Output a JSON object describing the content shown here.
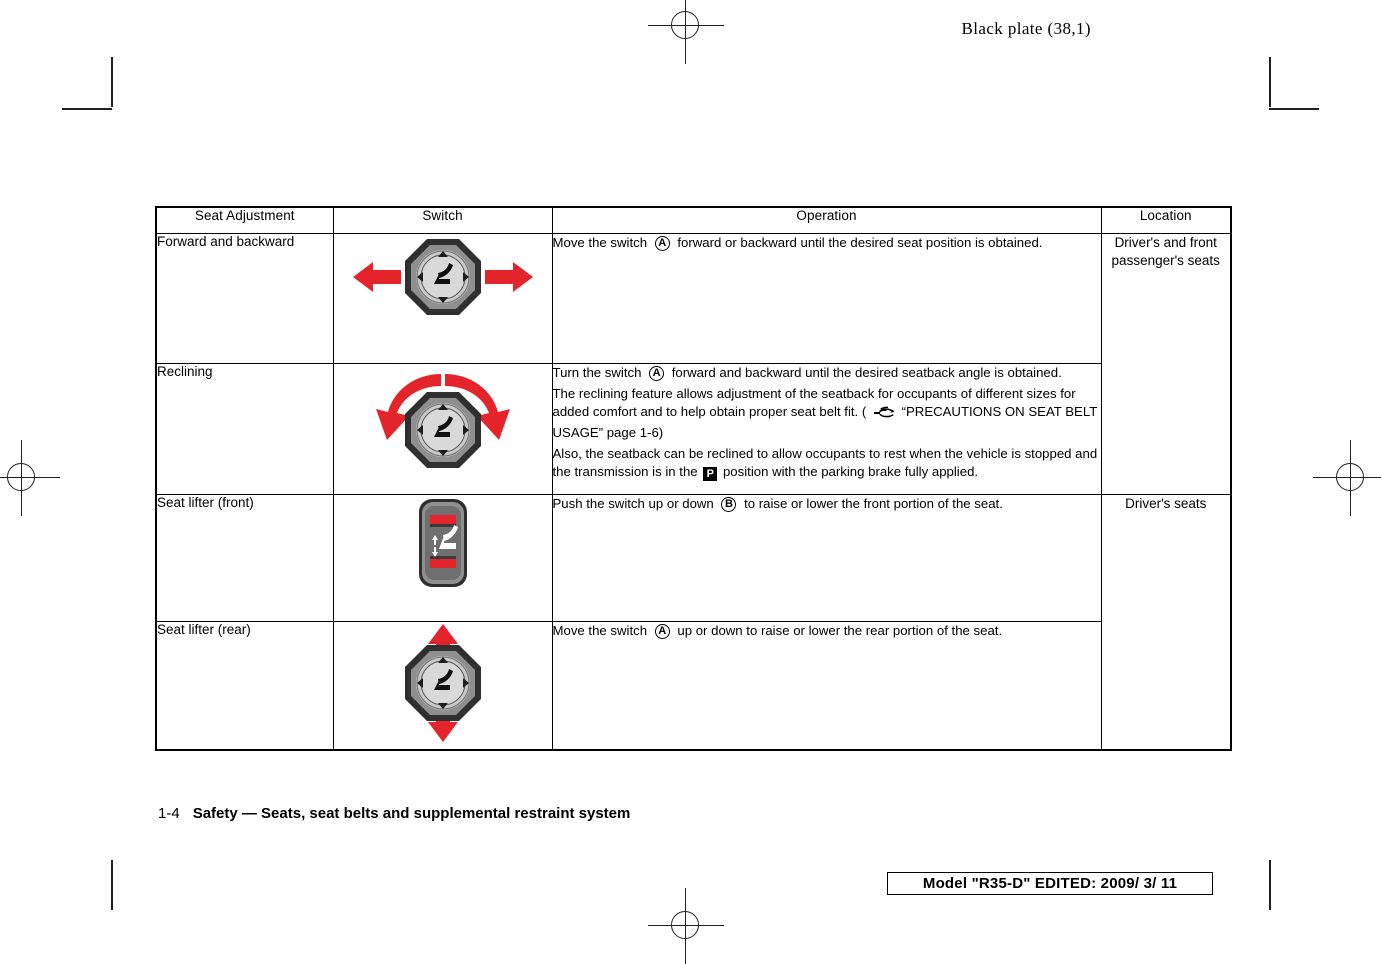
{
  "page": {
    "plate_label": "Black plate (38,1)",
    "footer_page_number": "1-4",
    "footer_title": "Safety — Seats, seat belts and supplemental restraint system",
    "model_stamp": "Model \"R35-D\"  EDITED:  2009/ 3/ 11"
  },
  "table": {
    "headers": {
      "seat_adjustment": "Seat Adjustment",
      "switch": "Switch",
      "operation": "Operation",
      "location": "Location"
    },
    "rows": [
      {
        "adjustment": "Forward and backward",
        "switch_icon": "rotary-seat-switch-horizontal-arrows",
        "operation": [
          {
            "segments": [
              {
                "type": "text",
                "text": "Move the switch "
              },
              {
                "type": "callout",
                "text": "A"
              },
              {
                "type": "text",
                "text": " forward or backward until the desired seat position is obtained."
              }
            ]
          }
        ]
      },
      {
        "adjustment": "Reclining",
        "switch_icon": "rotary-seat-switch-curved-arrows",
        "operation": [
          {
            "segments": [
              {
                "type": "text",
                "text": "Turn the switch "
              },
              {
                "type": "callout",
                "text": "A"
              },
              {
                "type": "text",
                "text": " forward and backward until the desired seatback angle is obtained."
              }
            ]
          },
          {
            "segments": [
              {
                "type": "text",
                "text": "The reclining feature allows adjustment of the seatback for occupants of different sizes for added comfort and to help obtain proper seat belt fit. ( "
              },
              {
                "type": "hand",
                "text": "☞"
              },
              {
                "type": "text",
                "text": " “PRECAUTIONS ON SEAT BELT USAGE” page 1-6)"
              }
            ]
          },
          {
            "segments": [
              {
                "type": "text",
                "text": "Also, the seatback can be reclined to allow occupants to rest when the vehicle is stopped and the transmission is in the "
              },
              {
                "type": "boxp",
                "text": "P"
              },
              {
                "type": "text",
                "text": " position with the parking brake fully applied."
              }
            ]
          }
        ]
      },
      {
        "adjustment": "Seat lifter (front)",
        "switch_icon": "rocker-seat-lifter-switch",
        "operation": [
          {
            "segments": [
              {
                "type": "text",
                "text": "Push the switch up or down "
              },
              {
                "type": "callout",
                "text": "B"
              },
              {
                "type": "text",
                "text": " to raise or lower the front portion of the seat."
              }
            ]
          }
        ]
      },
      {
        "adjustment": "Seat lifter (rear)",
        "switch_icon": "rotary-seat-switch-vertical-arrows",
        "operation": [
          {
            "segments": [
              {
                "type": "text",
                "text": "Move the switch "
              },
              {
                "type": "callout",
                "text": "A"
              },
              {
                "type": "text",
                "text": " up or down to raise or lower the rear portion of the seat."
              }
            ]
          }
        ]
      }
    ],
    "locations": [
      {
        "label": "Driver's and front passenger's seats",
        "rowspan": 2
      },
      {
        "label": "Driver's seats",
        "rowspan": 2
      }
    ]
  },
  "colors": {
    "arrow_red": "#e3242b",
    "ink": "#000000",
    "switch_body_dark": "#3f3f3f",
    "switch_body_mid": "#9a9a9a",
    "switch_body_light": "#cfcfcf"
  }
}
